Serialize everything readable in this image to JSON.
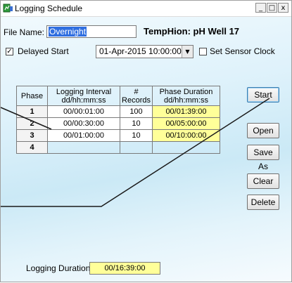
{
  "window": {
    "title": "Logging Schedule",
    "buttons": {
      "minimize": "_",
      "maximize": "□",
      "close": "x"
    }
  },
  "file_name": {
    "label": "File Name:",
    "value": "Overnight"
  },
  "instrument": "TempHion: pH Well 17",
  "delayed_start": {
    "label": "Delayed Start",
    "checked": true,
    "datetime": "01-Apr-2015 10:00:00"
  },
  "set_sensor_clock": {
    "label": "Set Sensor Clock",
    "checked": false
  },
  "table": {
    "headers": {
      "phase": "Phase",
      "interval_line1": "Logging Interval",
      "interval_line2": "dd/hh:mm:ss",
      "records_line1": "#",
      "records_line2": "Records",
      "duration_line1": "Phase Duration",
      "duration_line2": "dd/hh:mm:ss"
    },
    "rows": [
      {
        "phase": "1",
        "interval": "00/00:01:00",
        "records": "100",
        "duration": "00/01:39:00"
      },
      {
        "phase": "2",
        "interval": "00/00:30:00",
        "records": "10",
        "duration": "00/05:00:00"
      },
      {
        "phase": "3",
        "interval": "00/01:00:00",
        "records": "10",
        "duration": "00/10:00:00"
      },
      {
        "phase": "4",
        "interval": "",
        "records": "",
        "duration": ""
      }
    ]
  },
  "buttons": {
    "start": "Start",
    "open": "Open",
    "save_as": "Save As",
    "clear": "Clear",
    "delete": "Delete"
  },
  "logging_duration": {
    "label": "Logging Duration:",
    "value": "00/16:39:00"
  },
  "colors": {
    "duration_fill": "#ffff99",
    "selection": "#2f6ee0",
    "accent_icon": "#2e9a3a"
  }
}
